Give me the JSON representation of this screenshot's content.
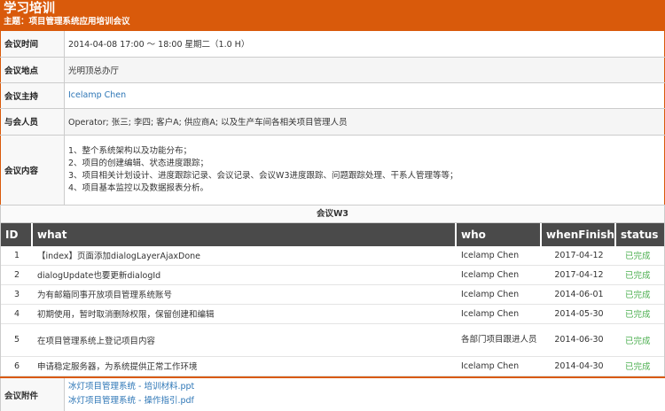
{
  "header": {
    "title": "学习培训",
    "subtitle": "主题：项目管理系统应用培训会议"
  },
  "info": {
    "time_label": "会议时间",
    "time_value": "2014-04-08 17:00 ～ 18:00   星期二（1.0 H）",
    "place_label": "会议地点",
    "place_value": "光明顶总办厅",
    "host_label": "会议主持",
    "host_value": "Icelamp Chen",
    "attendees_label": "与会人员",
    "attendees_value": "Operator; 张三; 李四; 客户A; 供应商A; 以及生产车间各相关项目管理人员",
    "content_label": "会议内容",
    "content_lines": [
      "1、整个系统架构以及功能分布；",
      "2、项目的创建编辑、状态进度跟踪；",
      "3、项目相关计划设计、进度跟踪记录、会议记录、会议W3进度跟踪、问题跟踪处理、干系人管理等等；",
      "4、项目基本监控以及数据报表分析。"
    ]
  },
  "w3": {
    "title": "会议W3",
    "headers": [
      "ID",
      "what",
      "who",
      "whenFinish",
      "status"
    ],
    "rows": [
      {
        "id": "1",
        "what": "【index】页面添加dialogLayerAjaxDone",
        "who": "Icelamp Chen",
        "when": "2017-04-12",
        "status": "已完成"
      },
      {
        "id": "2",
        "what": "dialogUpdate也要更新dialogId",
        "who": "Icelamp Chen",
        "when": "2017-04-12",
        "status": "已完成"
      },
      {
        "id": "3",
        "what": "为有邮箱同事开放项目管理系统账号",
        "who": "Icelamp Chen",
        "when": "2014-06-01",
        "status": "已完成"
      },
      {
        "id": "4",
        "what": "初期使用，暂时取消删除权限，保留创建和编辑",
        "who": "Icelamp Chen",
        "when": "2014-05-30",
        "status": "已完成"
      },
      {
        "id": "5",
        "what": "在项目管理系统上登记项目内容",
        "who": "各部门项目跟进人员",
        "when": "2014-06-30",
        "status": "已完成"
      },
      {
        "id": "6",
        "what": "申请稳定服务器，为系统提供正常工作环境",
        "who": "Icelamp Chen",
        "when": "2014-04-30",
        "status": "已完成"
      }
    ]
  },
  "attachments": {
    "label": "会议附件",
    "files": [
      "冰灯项目管理系统 - 培训材料.ppt",
      "冰灯项目管理系统 - 操作指引.pdf"
    ]
  },
  "colors": {
    "accent": "#d95a0b",
    "header_bg": "#4a4a4a",
    "status_done": "#4caf50",
    "link": "#2d76b6"
  }
}
